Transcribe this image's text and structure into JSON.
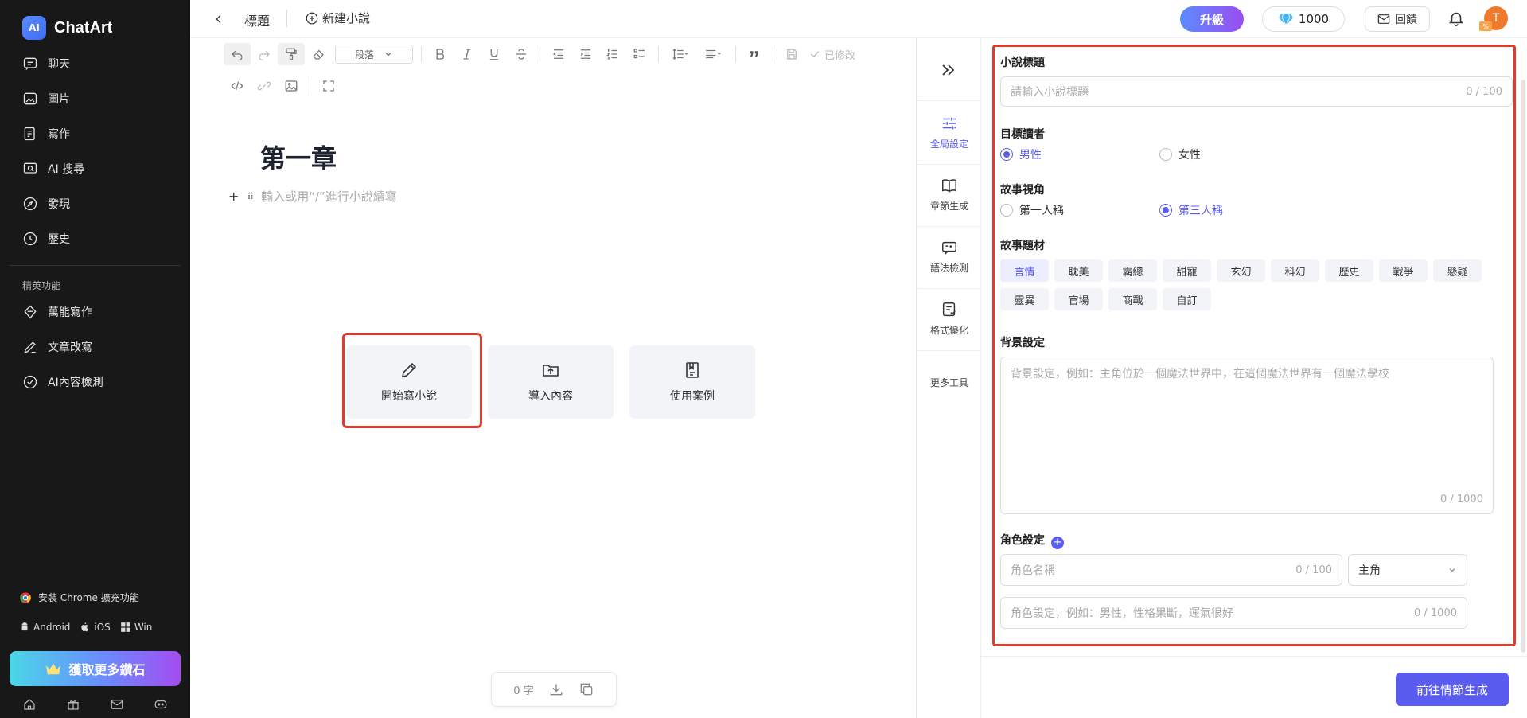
{
  "app": {
    "name": "ChatArt",
    "logo_mark": "AI"
  },
  "sidebar": {
    "items": [
      {
        "label": "聊天",
        "icon": "chat-icon"
      },
      {
        "label": "圖片",
        "icon": "image-icon"
      },
      {
        "label": "寫作",
        "icon": "write-icon"
      },
      {
        "label": "AI 搜尋",
        "icon": "search-icon"
      },
      {
        "label": "發現",
        "icon": "compass-icon"
      },
      {
        "label": "歷史",
        "icon": "history-icon"
      }
    ],
    "section_label": "精英功能",
    "elite_items": [
      {
        "label": "萬能寫作",
        "icon": "diamond-pen-icon"
      },
      {
        "label": "文章改寫",
        "icon": "rewrite-icon"
      },
      {
        "label": "AI內容檢測",
        "icon": "check-circle-icon"
      }
    ],
    "install_chrome": "安裝 Chrome 擴充功能",
    "platforms": [
      "Android",
      "iOS",
      "Win"
    ],
    "cta_label": "獲取更多鑽石"
  },
  "topbar": {
    "title": "標題",
    "new_novel": "新建小說",
    "upgrade": "升級",
    "diamonds": "1000",
    "feedback": "回饋",
    "avatar_letter": "T",
    "avatar_badge": "%"
  },
  "editor": {
    "paragraph_select": "段落",
    "modified": "已修改",
    "chapter_title": "第一章",
    "placeholder": "輸入或用“/”進行小說續寫",
    "cards": [
      {
        "label": "開始寫小說",
        "icon": "pencil-icon"
      },
      {
        "label": "導入內容",
        "icon": "upload-folder-icon"
      },
      {
        "label": "使用案例",
        "icon": "document-icon"
      }
    ],
    "word_count": "0 字"
  },
  "rail": {
    "items": [
      {
        "label": "全局設定",
        "icon": "sliders-icon",
        "active": true
      },
      {
        "label": "章節生成",
        "icon": "book-icon"
      },
      {
        "label": "語法檢測",
        "icon": "grammar-icon"
      },
      {
        "label": "格式優化",
        "icon": "format-icon"
      },
      {
        "label": "更多工具"
      }
    ]
  },
  "panel": {
    "title_label": "小說標題",
    "title_placeholder": "請輸入小說標題",
    "title_counter": "0 / 100",
    "audience_label": "目標讀者",
    "audience_options": [
      "男性",
      "女性"
    ],
    "audience_selected": "男性",
    "pov_label": "故事視角",
    "pov_options": [
      "第一人稱",
      "第三人稱"
    ],
    "pov_selected": "第三人稱",
    "genre_label": "故事題材",
    "genres": [
      "言情",
      "耽美",
      "霸總",
      "甜寵",
      "玄幻",
      "科幻",
      "歷史",
      "戰爭",
      "懸疑",
      "靈異",
      "官場",
      "商戰",
      "自訂"
    ],
    "genre_selected": "言情",
    "background_label": "背景設定",
    "background_placeholder": "背景設定，例如：主角位於一個魔法世界中，在這個魔法世界有一個魔法學校",
    "background_counter": "0 / 1000",
    "character_label": "角色設定",
    "character_name_placeholder": "角色名稱",
    "character_name_counter": "0 / 100",
    "role_selected": "主角",
    "character_desc_placeholder": "角色設定，例如：男性，性格果斷，運氣很好",
    "character_desc_counter": "0 / 1000",
    "generate_button": "前往情節生成"
  },
  "colors": {
    "accent": "#5a5cf0",
    "highlight": "#e23b2e",
    "sidebar_bg": "#181818"
  }
}
